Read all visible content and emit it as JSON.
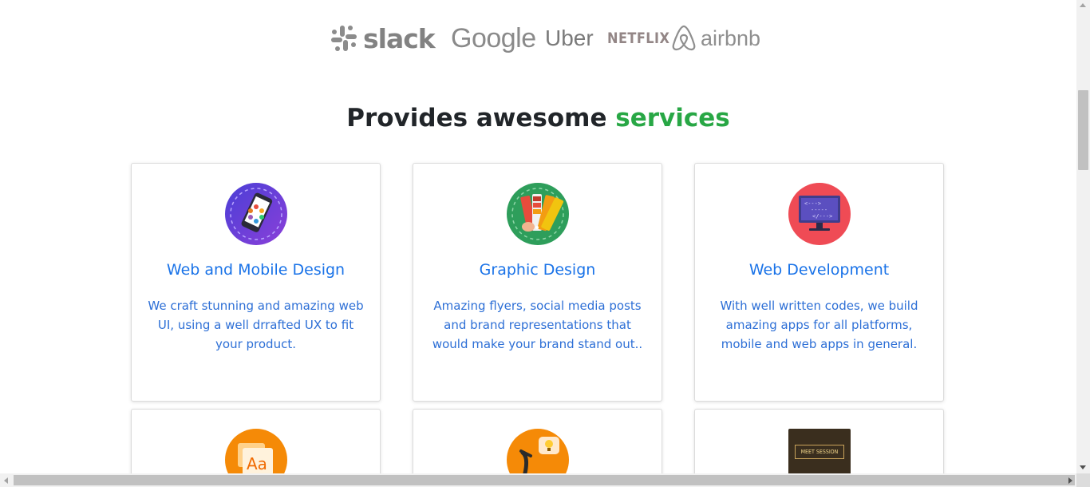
{
  "brand_logos": [
    {
      "name": "slack",
      "label": "slack"
    },
    {
      "name": "google",
      "label": "Google"
    },
    {
      "name": "uber",
      "label": "Uber"
    },
    {
      "name": "netflix",
      "label": "NETFLIX"
    },
    {
      "name": "airbnb",
      "label": "airbnb"
    }
  ],
  "section": {
    "title_prefix": "Provides awesome ",
    "title_accent": "services",
    "accent_color": "#28a745"
  },
  "services": [
    {
      "title": "Web and Mobile Design",
      "description": "We craft stunning and amazing web UI, using a well drrafted UX to fit your product.",
      "icon": "mobile-design-icon",
      "icon_color": "#6a3fd6"
    },
    {
      "title": "Graphic Design",
      "description": "Amazing flyers, social media posts and brand representations that would make your brand stand out..",
      "icon": "color-palette-icon",
      "icon_color": "#2e9e5b"
    },
    {
      "title": "Web Development",
      "description": "With well written codes, we build amazing apps for all platforms, mobile and web apps in general.",
      "icon": "code-monitor-icon",
      "icon_color": "#ef4b55"
    },
    {
      "title": "",
      "description": "",
      "icon": "typography-icon",
      "icon_color": "#f58a07"
    },
    {
      "title": "",
      "description": "",
      "icon": "idea-icon",
      "icon_color": "#f58a07"
    },
    {
      "title": "",
      "description": "",
      "icon": "meet-session-icon",
      "icon_label": "MEET SESSION",
      "icon_color": "#3a2e1e"
    }
  ],
  "colors": {
    "card_title": "#1a73e8",
    "card_text": "#2d6fd6",
    "logo_gray": "#8a8a8a"
  }
}
